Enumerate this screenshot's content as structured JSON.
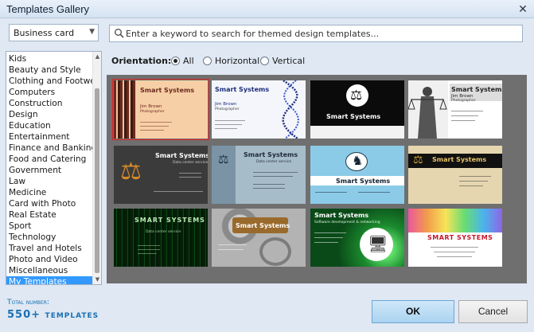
{
  "window": {
    "title": "Templates Gallery",
    "close_glyph": "✕"
  },
  "category_combo": {
    "value": "Business card"
  },
  "categories": [
    "Kids",
    "Beauty and Style",
    "Clothing and Footwear",
    "Computers",
    "Construction",
    "Design",
    "Education",
    "Entertainment",
    "Finance and Banking",
    "Food and Catering",
    "Government",
    "Law",
    "Medicine",
    "Card with Photo",
    "Real Estate",
    "Sport",
    "Technology",
    "Travel and Hotels",
    "Photo and Video",
    "Miscellaneous",
    "My Templates"
  ],
  "selected_category": "My Templates",
  "search": {
    "placeholder": "Enter a keyword to search for themed design templates...",
    "value": ""
  },
  "orientation": {
    "label": "Orientation:",
    "options": [
      "All",
      "Horizontal",
      "Vertical"
    ],
    "selected": "All"
  },
  "templates": [
    {
      "name": "Smart Systems",
      "person": "Jim Brown",
      "role": "Photographer",
      "theme": "peach-stripes",
      "selected": true
    },
    {
      "name": "Smart Systems",
      "person": "Jim Brown",
      "role": "Photographer",
      "theme": "dna-white"
    },
    {
      "name": "Smart Systems",
      "theme": "black-scales"
    },
    {
      "name": "Smart Systems",
      "person": "Jim Brown",
      "role": "Photographer",
      "theme": "justice-statue"
    },
    {
      "name": "Smart Systems",
      "role": "Data center service",
      "theme": "dark-scales"
    },
    {
      "name": "Smart Systems",
      "role": "Data center service",
      "theme": "slate-scales"
    },
    {
      "name": "Smart Systems",
      "theme": "lightblue-silhouette"
    },
    {
      "name": "Smart Systems",
      "theme": "kraft-scales"
    },
    {
      "name": "SMART SYSTEMS",
      "role": "Data center service",
      "theme": "matrix"
    },
    {
      "name": "Smart Systems",
      "theme": "gears"
    },
    {
      "name": "Smart Systems",
      "role": "Software development & networking",
      "theme": "green-tech"
    },
    {
      "name": "SMART SYSTEMS",
      "theme": "rainbow"
    }
  ],
  "footer": {
    "total_label": "Total number:",
    "total_value": "550+ templates",
    "ok_label": "OK",
    "cancel_label": "Cancel"
  },
  "colors": {
    "accent": "#3399ff",
    "selection_outline": "#dd2222",
    "gallery_bg": "#6f6f6f",
    "brand_text": "#1a6fb3"
  }
}
